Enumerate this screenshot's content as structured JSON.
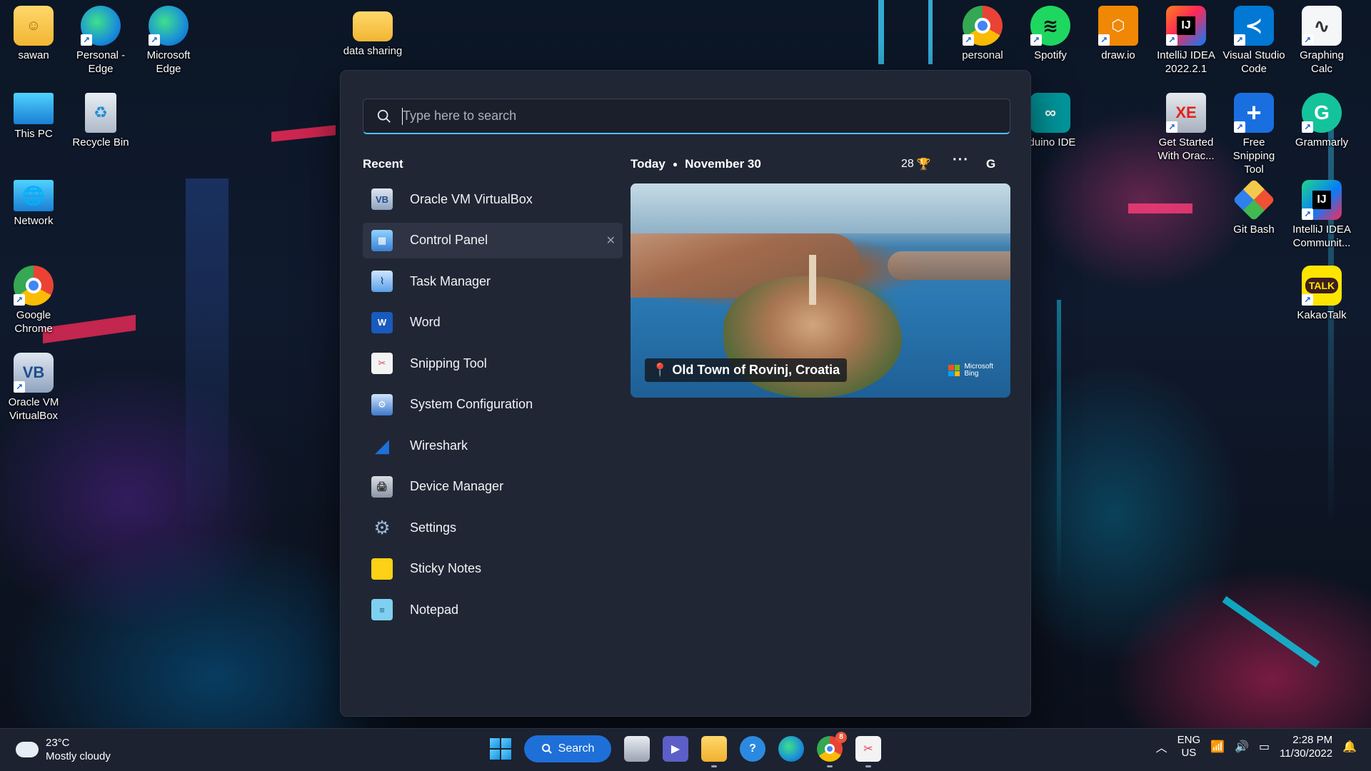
{
  "desktop": {
    "icons_left": [
      {
        "label": "sawan",
        "icon": "user-folder-icon"
      },
      {
        "label": "Personal -\nEdge",
        "icon": "edge-icon"
      },
      {
        "label": "Microsoft\nEdge",
        "icon": "edge-icon"
      },
      {
        "label": "data sharing",
        "icon": "folder-icon"
      },
      {
        "label": "This PC",
        "icon": "monitor-icon"
      },
      {
        "label": "Recycle Bin",
        "icon": "recycle-bin-icon"
      },
      {
        "label": "Network",
        "icon": "network-icon"
      },
      {
        "label": "Google\nChrome",
        "icon": "chrome-icon"
      },
      {
        "label": "Oracle VM\nVirtualBox",
        "icon": "virtualbox-icon"
      }
    ],
    "icons_right": [
      {
        "label": "personal",
        "icon": "chrome-icon"
      },
      {
        "label": "Spotify",
        "icon": "spotify-icon"
      },
      {
        "label": "draw.io",
        "icon": "drawio-icon"
      },
      {
        "label": "IntelliJ IDEA\n2022.2.1",
        "icon": "intellij-icon"
      },
      {
        "label": "Visual Studio\nCode",
        "icon": "vscode-icon"
      },
      {
        "label": "Graphing\nCalc",
        "icon": "graphing-calc-icon"
      },
      {
        "label": "rduino IDE",
        "icon": "arduino-icon"
      },
      {
        "label": "Get Started\nWith Orac...",
        "icon": "oracle-db-icon"
      },
      {
        "label": "Free Snipping\nTool",
        "icon": "snipping-plus-icon"
      },
      {
        "label": "Grammarly",
        "icon": "grammarly-icon"
      },
      {
        "label": "Git Bash",
        "icon": "git-bash-icon"
      },
      {
        "label": "IntelliJ IDEA\nCommunit...",
        "icon": "intellij-icon"
      },
      {
        "label": "KakaoTalk",
        "icon": "kakaotalk-icon"
      }
    ]
  },
  "search_panel": {
    "search": {
      "placeholder": "Type here to search",
      "value": ""
    },
    "recent_heading": "Recent",
    "recent": [
      {
        "label": "Oracle VM VirtualBox",
        "icon": "virtualbox-icon"
      },
      {
        "label": "Control Panel",
        "icon": "control-panel-icon",
        "selected": true
      },
      {
        "label": "Task Manager",
        "icon": "task-manager-icon"
      },
      {
        "label": "Word",
        "icon": "word-icon"
      },
      {
        "label": "Snipping Tool",
        "icon": "snipping-tool-icon"
      },
      {
        "label": "System Configuration",
        "icon": "system-config-icon"
      },
      {
        "label": "Wireshark",
        "icon": "wireshark-icon"
      },
      {
        "label": "Device Manager",
        "icon": "device-manager-icon"
      },
      {
        "label": "Settings",
        "icon": "settings-gear-icon"
      },
      {
        "label": "Sticky Notes",
        "icon": "sticky-notes-icon"
      },
      {
        "label": "Notepad",
        "icon": "notepad-icon"
      }
    ],
    "today_label": "Today",
    "date_label": "November 30",
    "points": "28",
    "more_label": "···",
    "account_initial": "G",
    "card": {
      "caption": "Old Town of Rovinj, Croatia",
      "brand_line1": "Microsoft",
      "brand_line2": "Bing"
    }
  },
  "taskbar": {
    "weather_temp": "23°C",
    "weather_desc": "Mostly cloudy",
    "search_label": "Search",
    "lang_top": "ENG",
    "lang_bottom": "US",
    "time": "2:28 PM",
    "date": "11/30/2022",
    "chrome_badge": "8"
  },
  "colors": {
    "accent": "#4cc2ff",
    "panel_bg": "#202634",
    "taskbar_bg": "#1c2230",
    "search_pill": "#1e6fd8"
  }
}
